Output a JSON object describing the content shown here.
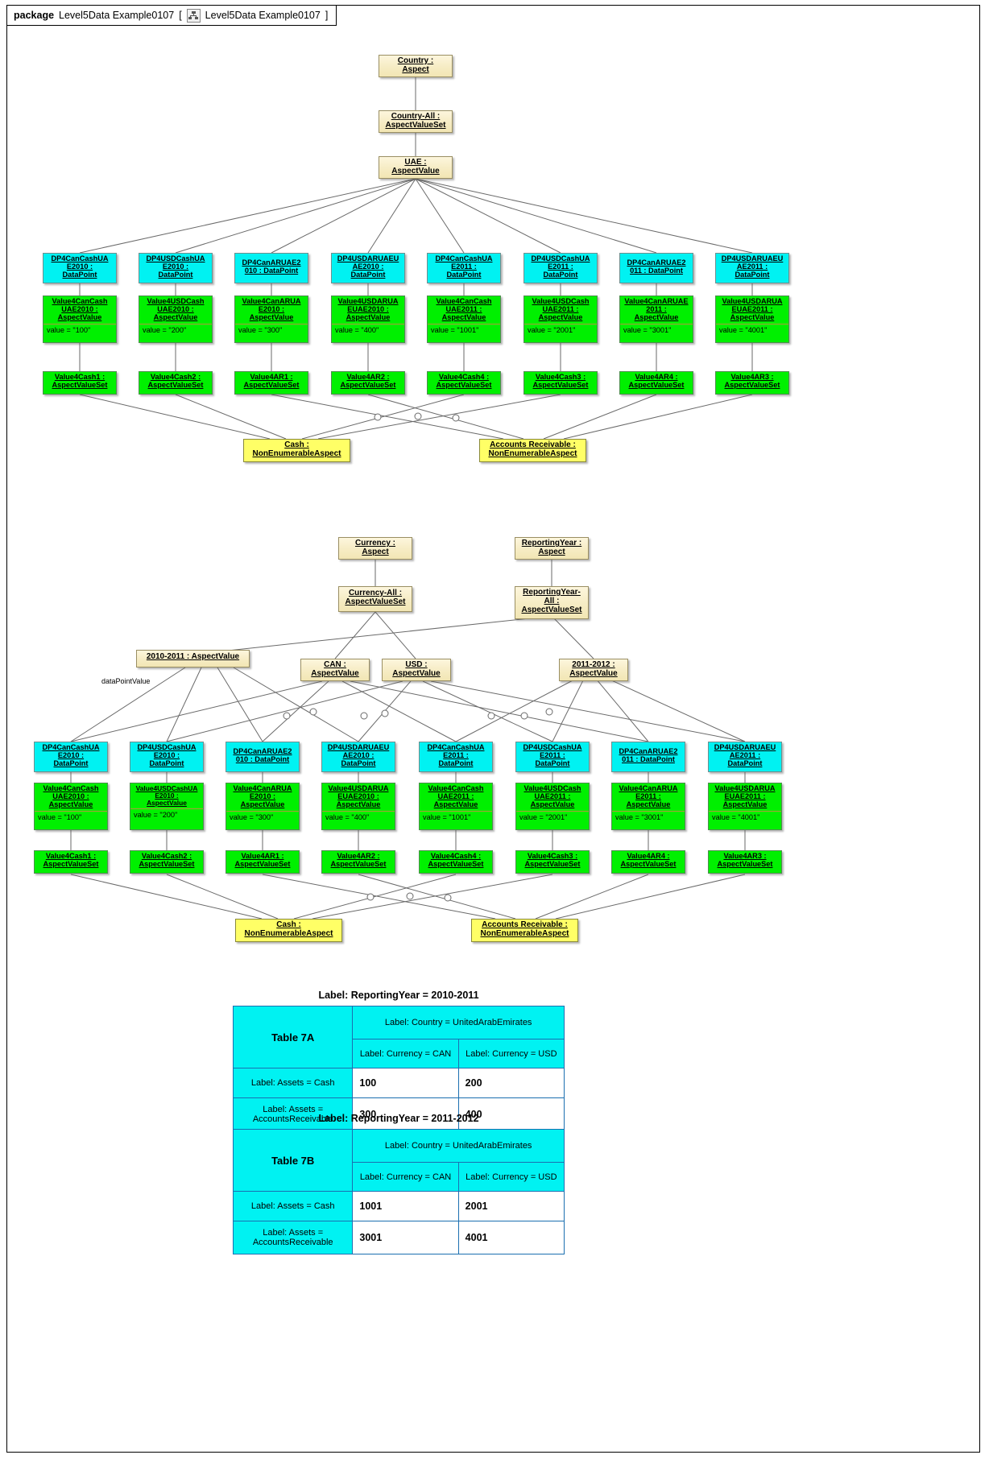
{
  "frame": {
    "keyword": "package",
    "name": "Level5Data Example0107",
    "bracket_open": "[",
    "diagram_icon": "diagram-icon",
    "diagram_name": "Level5Data Example0107",
    "bracket_close": "]"
  },
  "colors": {
    "aspect": "#f6ecc4",
    "nonenumerable_aspect": "#ffff66",
    "datapoint": "#00f2f2",
    "aspect_value": "#00f000",
    "table_border": "#1b6fb0"
  },
  "top_cluster": {
    "aspect": {
      "line1": "Country :",
      "line2": "Aspect"
    },
    "aspect_value_set": {
      "line1": "Country-All :",
      "line2": "AspectValueSet"
    },
    "aspect_value": {
      "line1": "UAE :",
      "line2": "AspectValue"
    },
    "datapoints": [
      {
        "line1": "DP4CanCashUA",
        "line2": "E2010 :",
        "line3": "DataPoint"
      },
      {
        "line1": "DP4USDCashUA",
        "line2": "E2010 :",
        "line3": "DataPoint"
      },
      {
        "line1": "DP4CanARUAE2",
        "line2": "010 : DataPoint",
        "line3": ""
      },
      {
        "line1": "DP4USDARUAEU",
        "line2": "AE2010 :",
        "line3": "DataPoint"
      },
      {
        "line1": "DP4CanCashUA",
        "line2": "E2011 :",
        "line3": "DataPoint"
      },
      {
        "line1": "DP4USDCashUA",
        "line2": "E2011 :",
        "line3": "DataPoint"
      },
      {
        "line1": "DP4CanARUAE2",
        "line2": "011 : DataPoint",
        "line3": ""
      },
      {
        "line1": "DP4USDARUAEU",
        "line2": "AE2011 :",
        "line3": "DataPoint"
      }
    ],
    "aspect_values": [
      {
        "line1": "Value4CanCash",
        "line2": "UAE2010 :",
        "line3": "AspectValue",
        "value": "value = \"100\""
      },
      {
        "line1": "Value4USDCash",
        "line2": "UAE2010 :",
        "line3": "AspectValue",
        "value": "value = \"200\""
      },
      {
        "line1": "Value4CanARUA",
        "line2": "E2010 :",
        "line3": "AspectValue",
        "value": "value = \"300\""
      },
      {
        "line1": "Value4USDARUA",
        "line2": "EUAE2010 :",
        "line3": "AspectValue",
        "value": "value = \"400\""
      },
      {
        "line1": "Value4CanCash",
        "line2": "UAE2011 :",
        "line3": "AspectValue",
        "value": "value = \"1001\""
      },
      {
        "line1": "Value4USDCash",
        "line2": "UAE2011 :",
        "line3": "AspectValue",
        "value": "value = \"2001\""
      },
      {
        "line1": "Value4CanARUAE",
        "line2": "2011 :",
        "line3": "AspectValue",
        "value": "value = \"3001\""
      },
      {
        "line1": "Value4USDARUA",
        "line2": "EUAE2011 :",
        "line3": "AspectValue",
        "value": "value = \"4001\""
      }
    ],
    "aspect_value_sets": [
      {
        "line1": "Value4Cash1 :",
        "line2": "AspectValueSet"
      },
      {
        "line1": "Value4Cash2 :",
        "line2": "AspectValueSet"
      },
      {
        "line1": "Value4AR1 :",
        "line2": "AspectValueSet"
      },
      {
        "line1": "Value4AR2 :",
        "line2": "AspectValueSet"
      },
      {
        "line1": "Value4Cash4 :",
        "line2": "AspectValueSet"
      },
      {
        "line1": "Value4Cash3 :",
        "line2": "AspectValueSet"
      },
      {
        "line1": "Value4AR4 :",
        "line2": "AspectValueSet"
      },
      {
        "line1": "Value4AR3 :",
        "line2": "AspectValueSet"
      }
    ],
    "cash": {
      "line1": "Cash :",
      "line2": "NonEnumerableAspect"
    },
    "accounts_receivable": {
      "line1": "Accounts Receivable :",
      "line2": "NonEnumerableAspect"
    }
  },
  "mid_cluster": {
    "currency_aspect": {
      "line1": "Currency :",
      "line2": "Aspect"
    },
    "reportingyear_aspect": {
      "line1": "ReportingYear :",
      "line2": "Aspect"
    },
    "currency_all": {
      "line1": "Currency-All :",
      "line2": "AspectValueSet"
    },
    "reportingyear_all": {
      "line1": "ReportingYear-",
      "line2": "All :",
      "line3": "AspectValueSet"
    },
    "year_2010": {
      "text": "2010-2011 : AspectValue"
    },
    "year_2011": {
      "line1": "2011-2012 :",
      "line2": "AspectValue"
    },
    "can": {
      "line1": "CAN :",
      "line2": "AspectValue"
    },
    "usd": {
      "line1": "USD :",
      "line2": "AspectValue"
    },
    "edge_label": "dataPointValue",
    "datapoints": [
      {
        "line1": "DP4CanCashUA",
        "line2": "E2010 :",
        "line3": "DataPoint"
      },
      {
        "line1": "DP4USDCashUA",
        "line2": "E2010 :",
        "line3": "DataPoint"
      },
      {
        "line1": "DP4CanARUAE2",
        "line2": "010 : DataPoint",
        "line3": ""
      },
      {
        "line1": "DP4USDARUAEU",
        "line2": "AE2010 :",
        "line3": "DataPoint"
      },
      {
        "line1": "DP4CanCashUA",
        "line2": "E2011 :",
        "line3": "DataPoint"
      },
      {
        "line1": "DP4USDCashUA",
        "line2": "E2011 :",
        "line3": "DataPoint"
      },
      {
        "line1": "DP4CanARUAE2",
        "line2": "011 : DataPoint",
        "line3": ""
      },
      {
        "line1": "DP4USDARUAEU",
        "line2": "AE2011 :",
        "line3": "DataPoint"
      }
    ],
    "aspect_values": [
      {
        "line1": "Value4CanCash",
        "line2": "UAE2010 :",
        "line3": "AspectValue",
        "value": "value = \"100\""
      },
      {
        "line1": "Value4USDCashUA",
        "line2": "E2010 :",
        "line3": "AspectValue",
        "value": "value = \"200\""
      },
      {
        "line1": "Value4CanARUA",
        "line2": "E2010 :",
        "line3": "AspectValue",
        "value": "value = \"300\""
      },
      {
        "line1": "Value4USDARUA",
        "line2": "EUAE2010 :",
        "line3": "AspectValue",
        "value": "value = \"400\""
      },
      {
        "line1": "Value4CanCash",
        "line2": "UAE2011 :",
        "line3": "AspectValue",
        "value": "value = \"1001\""
      },
      {
        "line1": "Value4USDCash",
        "line2": "UAE2011 :",
        "line3": "AspectValue",
        "value": "value = \"2001\""
      },
      {
        "line1": "Value4CanARUA",
        "line2": "E2011 :",
        "line3": "AspectValue",
        "value": "value = \"3001\""
      },
      {
        "line1": "Value4USDARUA",
        "line2": "EUAE2011 :",
        "line3": "AspectValue",
        "value": "value = \"4001\""
      }
    ],
    "aspect_value_sets": [
      {
        "line1": "Value4Cash1 :",
        "line2": "AspectValueSet"
      },
      {
        "line1": "Value4Cash2 :",
        "line2": "AspectValueSet"
      },
      {
        "line1": "Value4AR1 :",
        "line2": "AspectValueSet"
      },
      {
        "line1": "Value4AR2 :",
        "line2": "AspectValueSet"
      },
      {
        "line1": "Value4Cash4 :",
        "line2": "AspectValueSet"
      },
      {
        "line1": "Value4Cash3 :",
        "line2": "AspectValueSet"
      },
      {
        "line1": "Value4AR4 :",
        "line2": "AspectValueSet"
      },
      {
        "line1": "Value4AR3 :",
        "line2": "AspectValueSet"
      }
    ],
    "cash": {
      "line1": "Cash :",
      "line2": "NonEnumerableAspect"
    },
    "accounts_receivable": {
      "line1": "Accounts Receivable :",
      "line2": "NonEnumerableAspect"
    }
  },
  "tables": [
    {
      "caption": "Label: ReportingYear = 2010-2011",
      "name": "Table 7A",
      "country_header": "Label: Country = UnitedArabEmirates",
      "col_headers": [
        "Label: Currency = CAN",
        "Label: Currency = USD"
      ],
      "rows": [
        {
          "label": "Label: Assets = Cash",
          "values": [
            "100",
            "200"
          ]
        },
        {
          "label": "Label: Assets = AccountsReceivable",
          "values": [
            "300",
            "400"
          ]
        }
      ]
    },
    {
      "caption": "Label: ReportingYear = 2011-2012",
      "name": "Table 7B",
      "country_header": "Label: Country = UnitedArabEmirates",
      "col_headers": [
        "Label: Currency = CAN",
        "Label: Currency = USD"
      ],
      "rows": [
        {
          "label": "Label: Assets = Cash",
          "values": [
            "1001",
            "2001"
          ]
        },
        {
          "label": "Label: Assets = AccountsReceivable",
          "values": [
            "3001",
            "4001"
          ]
        }
      ]
    }
  ]
}
